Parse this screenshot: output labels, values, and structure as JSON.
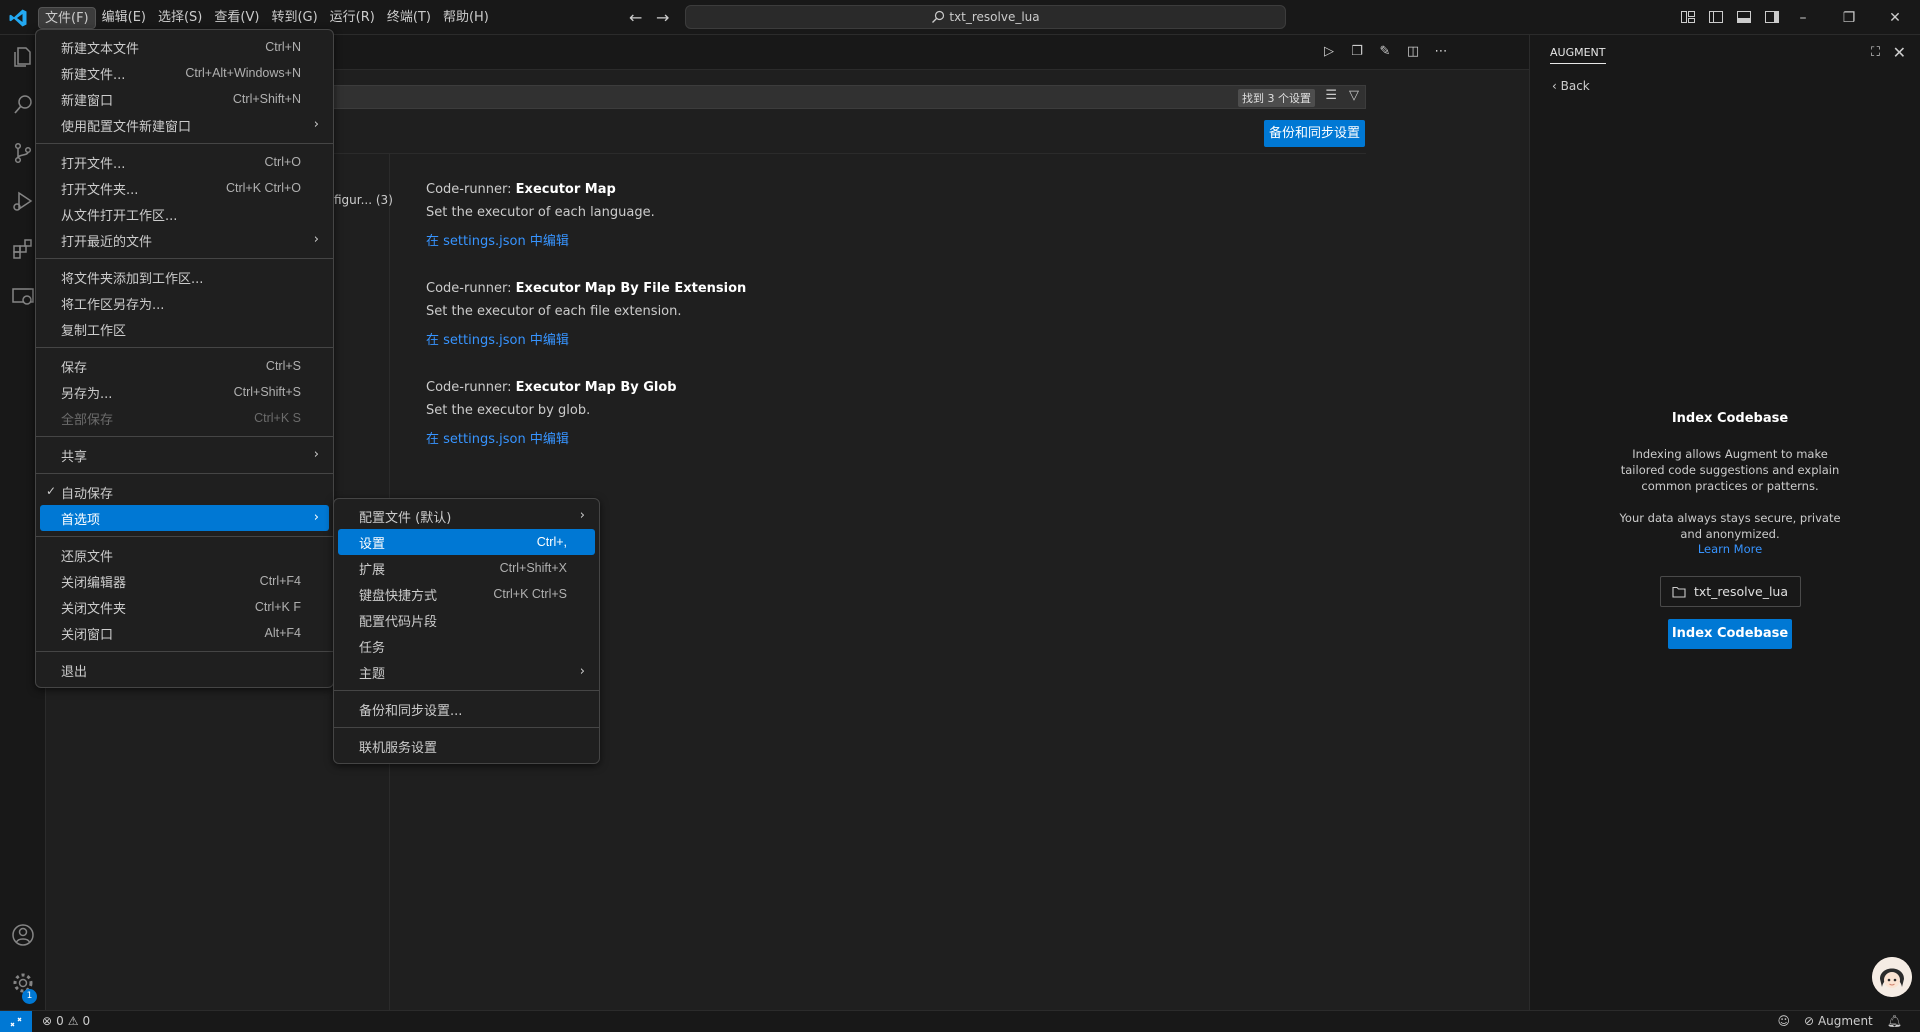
{
  "titlebar": {
    "menus": [
      "文件(F)",
      "编辑(E)",
      "选择(S)",
      "查看(V)",
      "转到(G)",
      "运行(R)",
      "终端(T)",
      "帮助(H)"
    ],
    "search_text": "txt_resolve_lua"
  },
  "editor": {
    "search_count": "找到 3 个设置",
    "backup_button": "备份和同步设置",
    "toc_item": "figur... (3)",
    "settings": [
      {
        "prefix": "Code-runner: ",
        "name": "Executor Map",
        "desc": "Set the executor of each language.",
        "link": "在 settings.json 中编辑"
      },
      {
        "prefix": "Code-runner: ",
        "name": "Executor Map By File Extension",
        "desc": "Set the executor of each file extension.",
        "link": "在 settings.json 中编辑"
      },
      {
        "prefix": "Code-runner: ",
        "name": "Executor Map By Glob",
        "desc": "Set the executor by glob.",
        "link": "在 settings.json 中编辑"
      }
    ]
  },
  "file_menu": {
    "items": [
      {
        "label": "新建文本文件",
        "kb": "Ctrl+N"
      },
      {
        "label": "新建文件...",
        "kb": "Ctrl+Alt+Windows+N"
      },
      {
        "label": "新建窗口",
        "kb": "Ctrl+Shift+N"
      },
      {
        "label": "使用配置文件新建窗口",
        "kb": ""
      },
      {
        "label": "打开文件...",
        "kb": "Ctrl+O"
      },
      {
        "label": "打开文件夹...",
        "kb": "Ctrl+K Ctrl+O"
      },
      {
        "label": "从文件打开工作区...",
        "kb": ""
      },
      {
        "label": "打开最近的文件",
        "kb": ""
      },
      {
        "label": "将文件夹添加到工作区...",
        "kb": ""
      },
      {
        "label": "将工作区另存为...",
        "kb": ""
      },
      {
        "label": "复制工作区",
        "kb": ""
      },
      {
        "label": "保存",
        "kb": "Ctrl+S"
      },
      {
        "label": "另存为...",
        "kb": "Ctrl+Shift+S"
      },
      {
        "label": "全部保存",
        "kb": "Ctrl+K S"
      },
      {
        "label": "共享",
        "kb": ""
      },
      {
        "label": "自动保存",
        "kb": ""
      },
      {
        "label": "首选项",
        "kb": ""
      },
      {
        "label": "还原文件",
        "kb": ""
      },
      {
        "label": "关闭编辑器",
        "kb": "Ctrl+F4"
      },
      {
        "label": "关闭文件夹",
        "kb": "Ctrl+K F"
      },
      {
        "label": "关闭窗口",
        "kb": "Alt+F4"
      },
      {
        "label": "退出",
        "kb": ""
      }
    ]
  },
  "prefs_menu": {
    "items": [
      {
        "label": "配置文件 (默认)",
        "kb": ""
      },
      {
        "label": "设置",
        "kb": "Ctrl+,"
      },
      {
        "label": "扩展",
        "kb": "Ctrl+Shift+X"
      },
      {
        "label": "键盘快捷方式",
        "kb": "Ctrl+K Ctrl+S"
      },
      {
        "label": "配置代码片段",
        "kb": ""
      },
      {
        "label": "任务",
        "kb": ""
      },
      {
        "label": "主题",
        "kb": ""
      },
      {
        "label": "备份和同步设置...",
        "kb": ""
      },
      {
        "label": "联机服务设置",
        "kb": ""
      }
    ]
  },
  "augment": {
    "tab": "AUGMENT",
    "back": "Back",
    "heading": "Index Codebase",
    "para1": "Indexing allows Augment to make tailored code suggestions and explain common practices or patterns.",
    "para2": "Your data always stays secure, private and anonymized.",
    "learn_more": "Learn More",
    "folder_button": "txt_resolve_lua",
    "index_button": "Index Codebase"
  },
  "statusbar": {
    "errors": "0",
    "warnings": "0",
    "augment": "Augment",
    "accent": "#0078d4"
  }
}
